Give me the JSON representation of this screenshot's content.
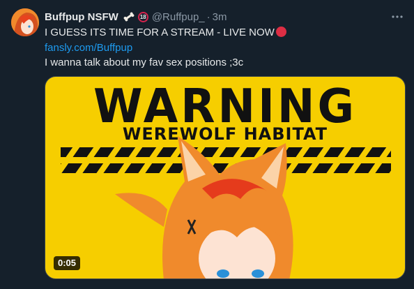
{
  "tweet": {
    "display_name": "Buffpup NSFW",
    "age_badge": "18",
    "handle": "@Ruffpup_",
    "separator": "·",
    "time": "3m",
    "more_icon": "more-icon",
    "text_line1": "I GUESS ITS TIME FOR A STREAM - LIVE NOW",
    "link": "fansly.com/Buffpup",
    "text_line3": "I wanna talk about my fav sex positions ;3c"
  },
  "media": {
    "warning": "WARNING",
    "subtitle": "WEREWOLF HABITAT",
    "duration": "0:05"
  },
  "colors": {
    "background": "#15202b",
    "link": "#1d9bf0",
    "warning_yellow": "#f6ce00",
    "hair_orange": "#f08a2c"
  }
}
